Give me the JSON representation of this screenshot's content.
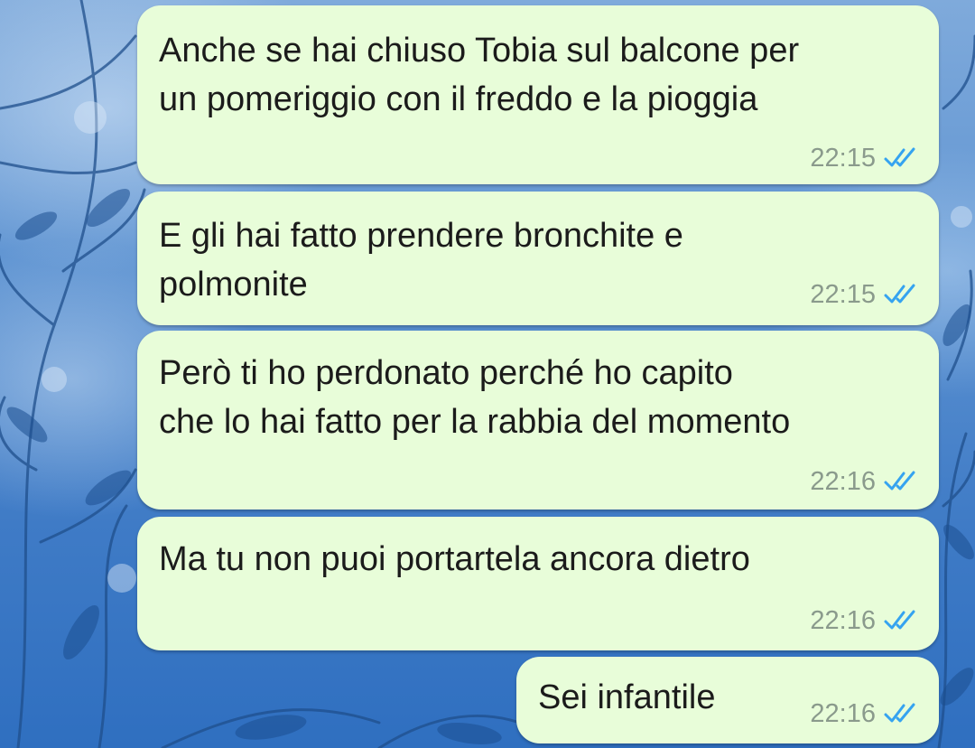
{
  "colors": {
    "bubble_background": "#e8fdd9",
    "message_text": "#1b1b1b",
    "timestamp": "#8a9a8c",
    "read_ticks": "#35a3f0",
    "wallpaper": "#5a8fcf"
  },
  "icons": {
    "read_receipt": "double-check-icon",
    "wallpaper": "floral-wallpaper"
  },
  "messages": [
    {
      "text": "Anche se hai chiuso Tobia sul balcone per\nun pomeriggio con il freddo e la pioggia",
      "time": "22:15",
      "status": "read"
    },
    {
      "text": "E gli hai fatto prendere bronchite e\npolmonite",
      "time": "22:15",
      "status": "read"
    },
    {
      "text": "Però ti ho perdonato perché ho capito\nche lo hai fatto per la rabbia del momento",
      "time": "22:16",
      "status": "read"
    },
    {
      "text": "Ma tu non puoi portartela ancora dietro",
      "time": "22:16",
      "status": "read"
    },
    {
      "text": "Sei infantile",
      "time": "22:16",
      "status": "read"
    }
  ]
}
